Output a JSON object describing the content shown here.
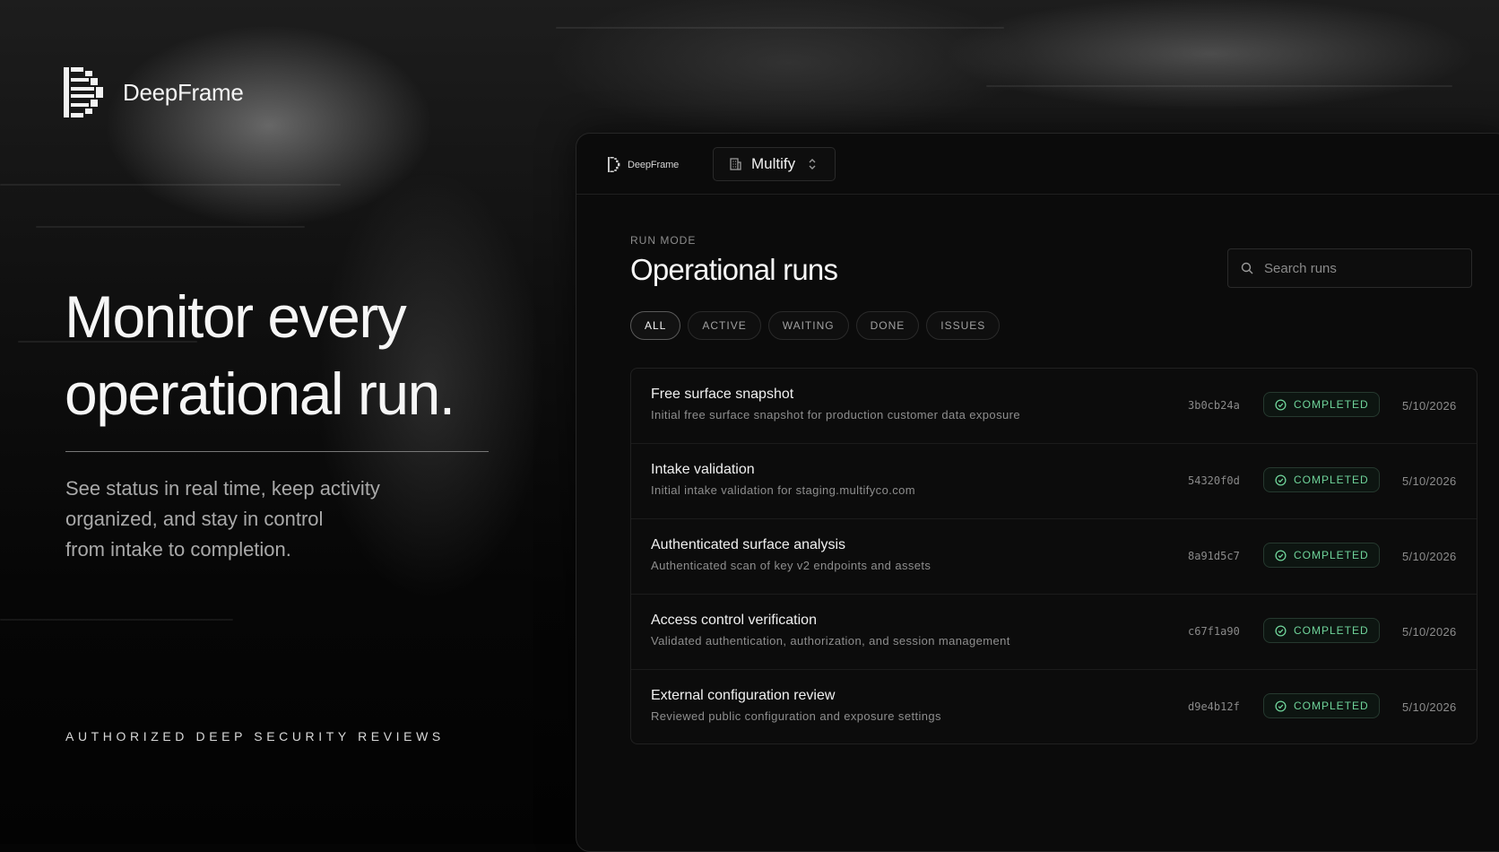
{
  "brand": {
    "name": "DeepFrame"
  },
  "hero": {
    "headline_lines": [
      "Monitor every",
      "operational run."
    ],
    "subcopy_lines": [
      "See status in real time, keep activity",
      "organized, and stay in control",
      "from intake to completion."
    ],
    "tagline": "AUTHORIZED DEEP SECURITY REVIEWS"
  },
  "app": {
    "brand_name": "DeepFrame",
    "workspace": {
      "name": "Multify",
      "icon": "building-icon",
      "toggle_icon": "chevron-up-down-icon"
    },
    "eyebrow": "RUN MODE",
    "title": "Operational runs",
    "search": {
      "placeholder": "Search runs",
      "value": "",
      "icon": "search-icon"
    },
    "filters": [
      {
        "label": "ALL",
        "active": true
      },
      {
        "label": "ACTIVE",
        "active": false
      },
      {
        "label": "WAITING",
        "active": false
      },
      {
        "label": "DONE",
        "active": false
      },
      {
        "label": "ISSUES",
        "active": false
      }
    ],
    "runs": [
      {
        "title": "Free surface snapshot",
        "description": "Initial free surface snapshot for production customer data exposure",
        "hash": "3b0cb24a",
        "status": "COMPLETED",
        "date": "5/10/2026"
      },
      {
        "title": "Intake validation",
        "description": "Initial intake validation for staging.multifyco.com",
        "hash": "54320f0d",
        "status": "COMPLETED",
        "date": "5/10/2026"
      },
      {
        "title": "Authenticated surface analysis",
        "description": "Authenticated scan of key v2 endpoints and assets",
        "hash": "8a91d5c7",
        "status": "COMPLETED",
        "date": "5/10/2026"
      },
      {
        "title": "Access control verification",
        "description": "Validated authentication, authorization, and session management",
        "hash": "c67f1a90",
        "status": "COMPLETED",
        "date": "5/10/2026"
      },
      {
        "title": "External configuration review",
        "description": "Reviewed public configuration and exposure settings",
        "hash": "d9e4b12f",
        "status": "COMPLETED",
        "date": "5/10/2026"
      }
    ],
    "colors": {
      "status_completed": "#6fd49a",
      "background": "#0b0b0b"
    }
  }
}
